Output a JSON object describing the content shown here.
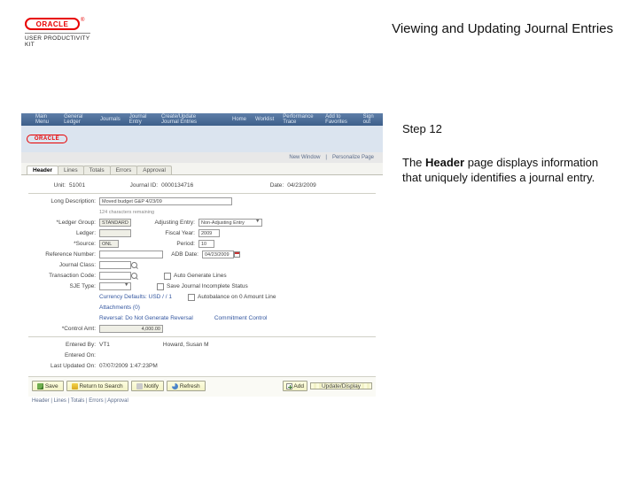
{
  "header": {
    "brand": "ORACLE",
    "upk": "USER PRODUCTIVITY KIT",
    "title": "Viewing and Updating Journal Entries"
  },
  "instruction": {
    "step_label": "Step 12",
    "body_prefix": "The ",
    "body_bold": "Header",
    "body_suffix": " page displays information that uniquely identifies a journal entry."
  },
  "nav": {
    "brand": "",
    "items": [
      "Main Menu",
      "General Ledger",
      "Journals",
      "Journal Entry",
      "Create/Update Journal Entries"
    ],
    "right": [
      "Home",
      "Worklist",
      "Performance Trace",
      "Add to Favorites",
      "Sign out"
    ]
  },
  "strip": {
    "new_window": "New Window",
    "personalize": "Personalize Page"
  },
  "tabs": [
    "Header",
    "Lines",
    "Totals",
    "Errors",
    "Approval"
  ],
  "form": {
    "unit_label": "Unit:",
    "unit_value": "51001",
    "journal_id_label": "Journal ID:",
    "journal_id_value": "0000134716",
    "date_label": "Date:",
    "date_value": "04/23/2009",
    "long_desc_label": "Long Description:",
    "long_desc_value": "Moved budget G&P 4/23/09",
    "chars254": "124 characters remaining",
    "ledger_group_label": "*Ledger Group:",
    "ledger_group_value": "STANDARD",
    "ledger_label": "Ledger:",
    "source_label": "*Source:",
    "source_value": "ONL",
    "ref_label": "Reference Number:",
    "journal_class_label": "Journal Class:",
    "transaction_code_label": "Transaction Code:",
    "adjusting_label": "Adjusting Entry:",
    "adjusting_value": "Non-Adjusting Entry",
    "fiscal_year_label": "Fiscal Year:",
    "fiscal_year_value": "2009",
    "period_label": "Period:",
    "period_value": "10",
    "adb_date_label": "ADB Date:",
    "adb_date_value": "04/23/2009",
    "auto_gen_label": "Auto Generate Lines",
    "save_incomplete_label": "Save Journal Incomplete Status",
    "autobalance_label": "Autobalance on 0 Amount Line",
    "sjetype_label": "SJE Type:",
    "currency_defaults": "Currency Defaults: USD / / 1",
    "attachments": "Attachments (0)",
    "reversal": "Reversal: Do Not Generate Reversal",
    "commitment": "Commitment Control",
    "ctrl_amt_label": "*Control Amt:",
    "ctrl_amt_value": "4,000.00",
    "entered_by_label": "Entered By:",
    "entered_by_value": "VT1",
    "entered_on_label": "Entered On:",
    "entered_by_name": "Howard, Susan M",
    "last_updated_label": "Last Updated On:",
    "last_updated_value": "07/07/2009 1:47:23PM"
  },
  "actions": {
    "save": "Save",
    "return": "Return to Search",
    "notify": "Notify",
    "refresh": "Refresh",
    "add": "Add",
    "update": "Update/Display",
    "footer": "Header | Lines | Totals | Errors | Approval"
  }
}
